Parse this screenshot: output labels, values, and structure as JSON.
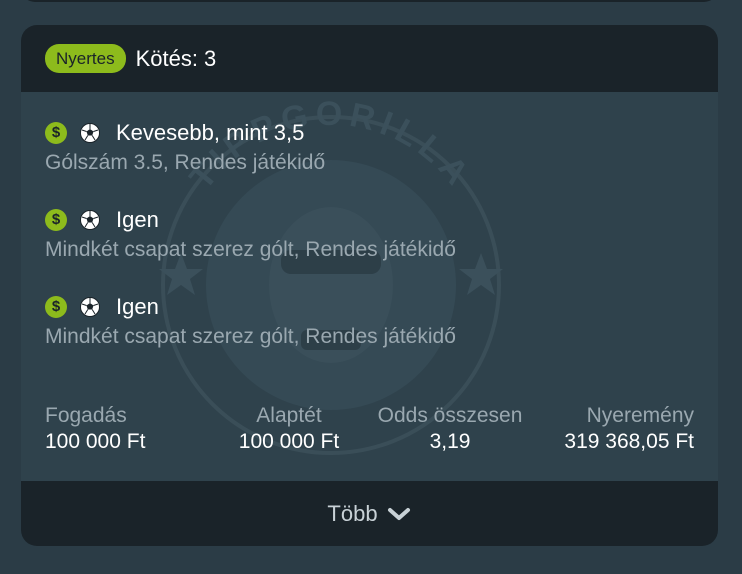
{
  "header": {
    "status_badge": "Nyertes",
    "title": "Kötés: 3"
  },
  "watermark_text": "TIPPGORILLA",
  "bets": [
    {
      "pick": "Kevesebb, mint 3,5",
      "description": "Gólszám 3.5, Rendes játékidő"
    },
    {
      "pick": "Igen",
      "description": "Mindkét csapat szerez gólt, Rendes játékidő"
    },
    {
      "pick": "Igen",
      "description": "Mindkét csapat szerez gólt, Rendes játékidő"
    }
  ],
  "stats": {
    "stake": {
      "label": "Fogadás",
      "value": "100 000 Ft"
    },
    "base_stake": {
      "label": "Alaptét",
      "value": "100 000 Ft"
    },
    "total_odds": {
      "label": "Odds összesen",
      "value": "3,19"
    },
    "winnings": {
      "label": "Nyeremény",
      "value": "319 368,05 Ft"
    }
  },
  "footer": {
    "more_label": "Több"
  },
  "icons": {
    "bet_status": "dollar-icon",
    "sport": "soccer-ball-icon",
    "expand": "chevron-down-icon"
  },
  "colors": {
    "accent": "#8dbb1c",
    "header_bg": "#1a2329",
    "card_bg": "#2f424c"
  }
}
